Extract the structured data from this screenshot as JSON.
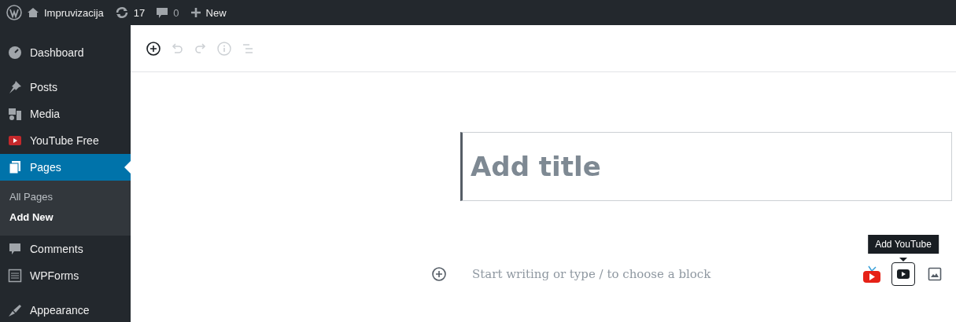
{
  "admin_bar": {
    "site_name": "Impruvizacija",
    "updates_count": "17",
    "comments_count": "0",
    "new_label": "New"
  },
  "sidebar": {
    "items": [
      {
        "label": "Dashboard",
        "selected": false
      },
      {
        "label": "Posts",
        "selected": false
      },
      {
        "label": "Media",
        "selected": false
      },
      {
        "label": "YouTube Free",
        "selected": false
      },
      {
        "label": "Pages",
        "selected": true,
        "children": [
          {
            "label": "All Pages",
            "selected": false
          },
          {
            "label": "Add New",
            "selected": true
          }
        ]
      },
      {
        "label": "Comments",
        "selected": false
      },
      {
        "label": "WPForms",
        "selected": false
      },
      {
        "label": "Appearance",
        "selected": false
      }
    ]
  },
  "editor_toolbar": [
    {
      "kind": "add",
      "disabled": false
    },
    {
      "kind": "undo",
      "disabled": true
    },
    {
      "kind": "redo",
      "disabled": true
    },
    {
      "kind": "info",
      "disabled": true
    },
    {
      "kind": "outline",
      "disabled": true
    }
  ],
  "title": {
    "placeholder": "Add title"
  },
  "block": {
    "placeholder": "Start writing or type / to choose a block"
  },
  "block_buttons": [
    {
      "kind": "youtube-plugin",
      "selected": false
    },
    {
      "kind": "youtube",
      "selected": true,
      "tooltip": "Add YouTube"
    },
    {
      "kind": "image",
      "selected": false
    }
  ]
}
